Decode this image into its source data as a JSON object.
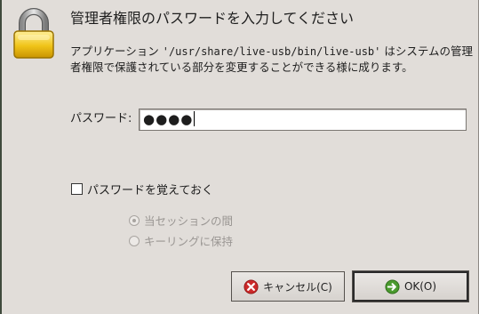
{
  "dialog": {
    "title": "管理者権限のパスワードを入力してください",
    "message_prefix": "アプリケーション ",
    "message_program": "'/usr/share/live-usb/bin/live-usb'",
    "message_suffix": " はシステムの管理者権限で保護されている部分を変更することができる様に成ります。"
  },
  "password": {
    "label": "パスワード:",
    "masked_value": "●●●●"
  },
  "remember_checkbox": {
    "label": "パスワードを覚えておく",
    "checked": false
  },
  "remember_options": [
    {
      "label": "当セッションの間",
      "selected": true,
      "enabled": false
    },
    {
      "label": "キーリングに保持",
      "selected": false,
      "enabled": false
    }
  ],
  "buttons": {
    "cancel": "キャンセル(C)",
    "ok": "OK(O)"
  },
  "icons": {
    "dialog": "lock-icon",
    "cancel": "cancel-icon",
    "ok": "ok-arrow-icon"
  },
  "colors": {
    "dialog_bg": "#e1ddd9",
    "lock_gold": "#e6b800",
    "cancel_red": "#cc2a2a",
    "ok_green": "#4a9a2e"
  }
}
